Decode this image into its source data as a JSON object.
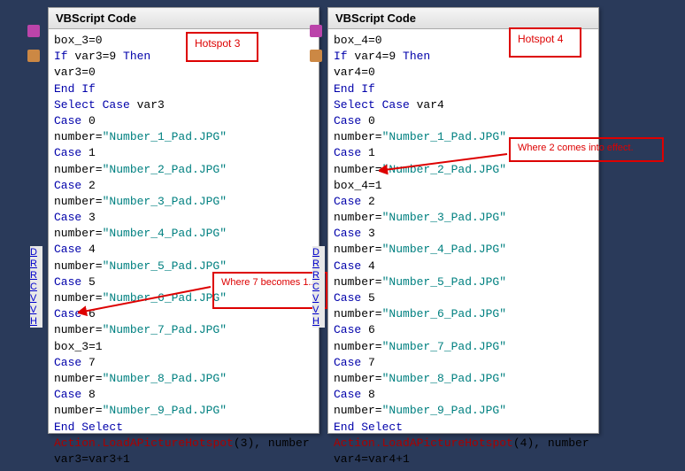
{
  "left": {
    "title": "VBScript Code",
    "callout1": "Hotspot 3",
    "callout2": "Where 7 becomes 1..",
    "lines": [
      {
        "t": "box_3=0"
      },
      {
        "k": "If",
        "t": " var3=9 ",
        "k2": "Then"
      },
      {
        "t": "var3=0"
      },
      {
        "k": "End If"
      },
      {
        "k": "Select Case",
        "t": " var3"
      },
      {
        "k": "Case",
        "t": " 0"
      },
      {
        "t": "number=",
        "s": "\"Number_1_Pad.JPG\""
      },
      {
        "k": "Case",
        "t": " 1"
      },
      {
        "t": "number=",
        "s": "\"Number_2_Pad.JPG\""
      },
      {
        "k": "Case",
        "t": " 2"
      },
      {
        "t": "number=",
        "s": "\"Number_3_Pad.JPG\""
      },
      {
        "k": "Case",
        "t": " 3"
      },
      {
        "t": "number=",
        "s": "\"Number_4_Pad.JPG\""
      },
      {
        "k": "Case",
        "t": " 4"
      },
      {
        "t": "number=",
        "s": "\"Number_5_Pad.JPG\""
      },
      {
        "k": "Case",
        "t": " 5"
      },
      {
        "t": "number=",
        "s": "\"Number_6_Pad.JPG\""
      },
      {
        "k": "Case",
        "t": " 6"
      },
      {
        "t": "number=",
        "s": "\"Number_7_Pad.JPG\""
      },
      {
        "t": "box_3=1"
      },
      {
        "k": "Case",
        "t": " 7"
      },
      {
        "t": "number=",
        "s": "\"Number_8_Pad.JPG\""
      },
      {
        "k": "Case",
        "t": " 8"
      },
      {
        "t": "number=",
        "s": "\"Number_9_Pad.JPG\""
      },
      {
        "k": "End Select"
      },
      {
        "f": "Action.LoadAPicture",
        "t": " ",
        "f2": "Hotspot",
        "t2": "(3), number"
      },
      {
        "t": "var3=var3+1"
      }
    ],
    "sidelinks": [
      "D",
      "R",
      "R",
      "C",
      "V",
      "V",
      "H"
    ]
  },
  "right": {
    "title": "VBScript Code",
    "callout1": "Hotspot 4",
    "callout2": "Where 2 comes into effect.",
    "lines": [
      {
        "t": "box_4=0"
      },
      {
        "k": "If",
        "t": " var4=9 ",
        "k2": "Then"
      },
      {
        "t": "var4=0"
      },
      {
        "k": "End If"
      },
      {
        "k": "Select Case",
        "t": " var4"
      },
      {
        "k": "Case",
        "t": " 0"
      },
      {
        "t": "number=",
        "s": "\"Number_1_Pad.JPG\""
      },
      {
        "k": "Case",
        "t": " 1"
      },
      {
        "t": "number=",
        "s": "\"Number_2_Pad.JPG\""
      },
      {
        "t": "box_4=1"
      },
      {
        "k": "Case",
        "t": " 2"
      },
      {
        "t": "number=",
        "s": "\"Number_3_Pad.JPG\""
      },
      {
        "k": "Case",
        "t": " 3"
      },
      {
        "t": "number=",
        "s": "\"Number_4_Pad.JPG\""
      },
      {
        "k": "Case",
        "t": " 4"
      },
      {
        "t": "number=",
        "s": "\"Number_5_Pad.JPG\""
      },
      {
        "k": "Case",
        "t": " 5"
      },
      {
        "t": "number=",
        "s": "\"Number_6_Pad.JPG\""
      },
      {
        "k": "Case",
        "t": " 6"
      },
      {
        "t": "number=",
        "s": "\"Number_7_Pad.JPG\""
      },
      {
        "k": "Case",
        "t": " 7"
      },
      {
        "t": "number=",
        "s": "\"Number_8_Pad.JPG\""
      },
      {
        "k": "Case",
        "t": " 8"
      },
      {
        "t": "number=",
        "s": "\"Number_9_Pad.JPG\""
      },
      {
        "k": "End Select"
      },
      {
        "f": "Action.LoadAPicture",
        "t": " ",
        "f2": "Hotspot",
        "t2": "(4), number"
      },
      {
        "t": "var4=var4+1"
      }
    ],
    "sidelinks": [
      "D",
      "R",
      "R",
      "C",
      "V",
      "V",
      "H"
    ]
  }
}
